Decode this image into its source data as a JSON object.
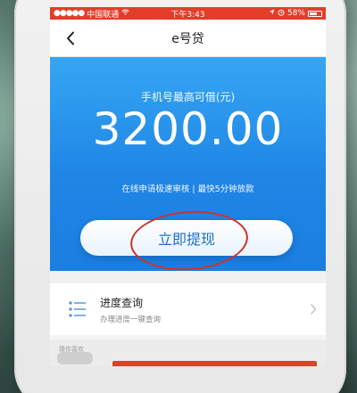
{
  "status_bar": {
    "carrier": "中国联通",
    "time": "下午3:43",
    "battery": "58%"
  },
  "nav": {
    "title": "e号贷"
  },
  "hero": {
    "label": "手机号最高可借(元)",
    "amount": "3200.00",
    "subtitle": "在线申请极速审核 | 最快5分钟放款",
    "button_label": "立即提现"
  },
  "progress": {
    "title": "进度查询",
    "subtitle": "办理进度一键查询"
  },
  "recommend": {
    "tag": "猜你喜欢"
  },
  "colors": {
    "status_bar_bg": "#e43d2a",
    "hero_blue": "#1f86e6",
    "annotation_red": "#d2302a"
  }
}
